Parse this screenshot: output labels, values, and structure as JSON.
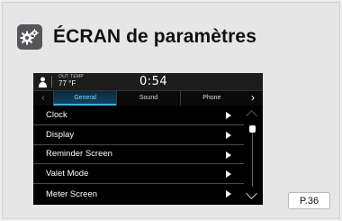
{
  "header": {
    "icon": "gear-icon",
    "title": "ÉCRAN de paramètres"
  },
  "status": {
    "person_icon": "person-icon",
    "out_temp_label": "OUT TEMP",
    "out_temp_value": "77 °F",
    "time": "0:54"
  },
  "tabs": {
    "items": [
      {
        "label": "General",
        "active": true
      },
      {
        "label": "Sound",
        "active": false
      },
      {
        "label": "Phone",
        "active": false
      }
    ]
  },
  "menu": {
    "items": [
      {
        "label": "Clock"
      },
      {
        "label": "Display"
      },
      {
        "label": "Reminder Screen"
      },
      {
        "label": "Valet Mode"
      },
      {
        "label": "Meter Screen"
      }
    ]
  },
  "page_ref": "P.36",
  "colors": {
    "active_tab": "#3fb0e8",
    "icon_bg": "#55555a"
  }
}
